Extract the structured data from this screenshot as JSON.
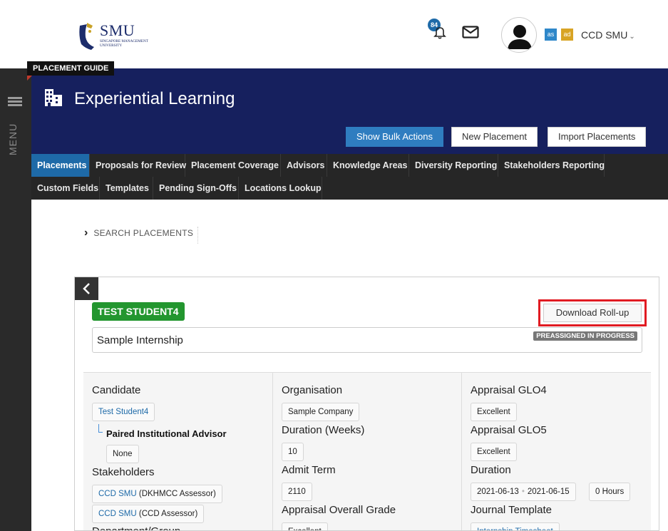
{
  "brand": {
    "name": "SMU",
    "subtitle": "SINGAPORE MANAGEMENT UNIVERSITY"
  },
  "topbar": {
    "notification_count": "84",
    "user_chip_1": "as",
    "user_chip_2": "ad",
    "user_name": "CCD SMU"
  },
  "sidemenu": {
    "label": "MENU"
  },
  "guide": {
    "label": "PLACEMENT GUIDE"
  },
  "header": {
    "title": "Experiential Learning",
    "buttons": {
      "bulk": "Show Bulk Actions",
      "new": "New Placement",
      "import": "Import Placements"
    }
  },
  "tabs": {
    "row1": [
      "Placements",
      "Proposals for Review",
      "Placement Coverage",
      "Advisors",
      "Knowledge Areas",
      "Diversity Reporting",
      "Stakeholders Reporting"
    ],
    "row2": [
      "Custom Fields",
      "Templates",
      "Pending Sign-Offs",
      "Locations Lookup"
    ],
    "active": "Placements"
  },
  "search": {
    "label": "SEARCH PLACEMENTS"
  },
  "placement": {
    "student": "TEST STUDENT4",
    "download_label": "Download Roll-up",
    "title": "Sample Internship",
    "status": "PREASSIGNED IN PROGRESS",
    "col1": {
      "candidate_label": "Candidate",
      "candidate_value": "Test Student4",
      "advisor_label": "Paired Institutional Advisor",
      "advisor_value": "None",
      "stakeholders_label": "Stakeholders",
      "stakeholder_1_name": "CCD SMU",
      "stakeholder_1_role": "(DKHMCC Assessor)",
      "stakeholder_2_name": "CCD SMU",
      "stakeholder_2_role": "(CCD Assessor)",
      "department_label": "Department/Group"
    },
    "col2": {
      "organisation_label": "Organisation",
      "organisation_value": "Sample Company",
      "duration_weeks_label": "Duration (Weeks)",
      "duration_weeks_value": "10",
      "admit_term_label": "Admit Term",
      "admit_term_value": "2110",
      "grade_label": "Appraisal Overall Grade",
      "grade_value": "Excellent"
    },
    "col3": {
      "glo4_label": "Appraisal GLO4",
      "glo4_value": "Excellent",
      "glo5_label": "Appraisal GLO5",
      "glo5_value": "Excellent",
      "duration_label": "Duration",
      "start_date": "2021-06-13",
      "end_date": "2021-06-15",
      "hours": "0 Hours",
      "journal_label": "Journal Template",
      "journal_value": "Internship Timesheet"
    }
  },
  "colors": {
    "header_navy": "#16205e",
    "tab_active": "#1e6aa8",
    "student_green": "#23962f",
    "highlight_red": "#e11b22",
    "primary_blue": "#2f7dc0"
  }
}
